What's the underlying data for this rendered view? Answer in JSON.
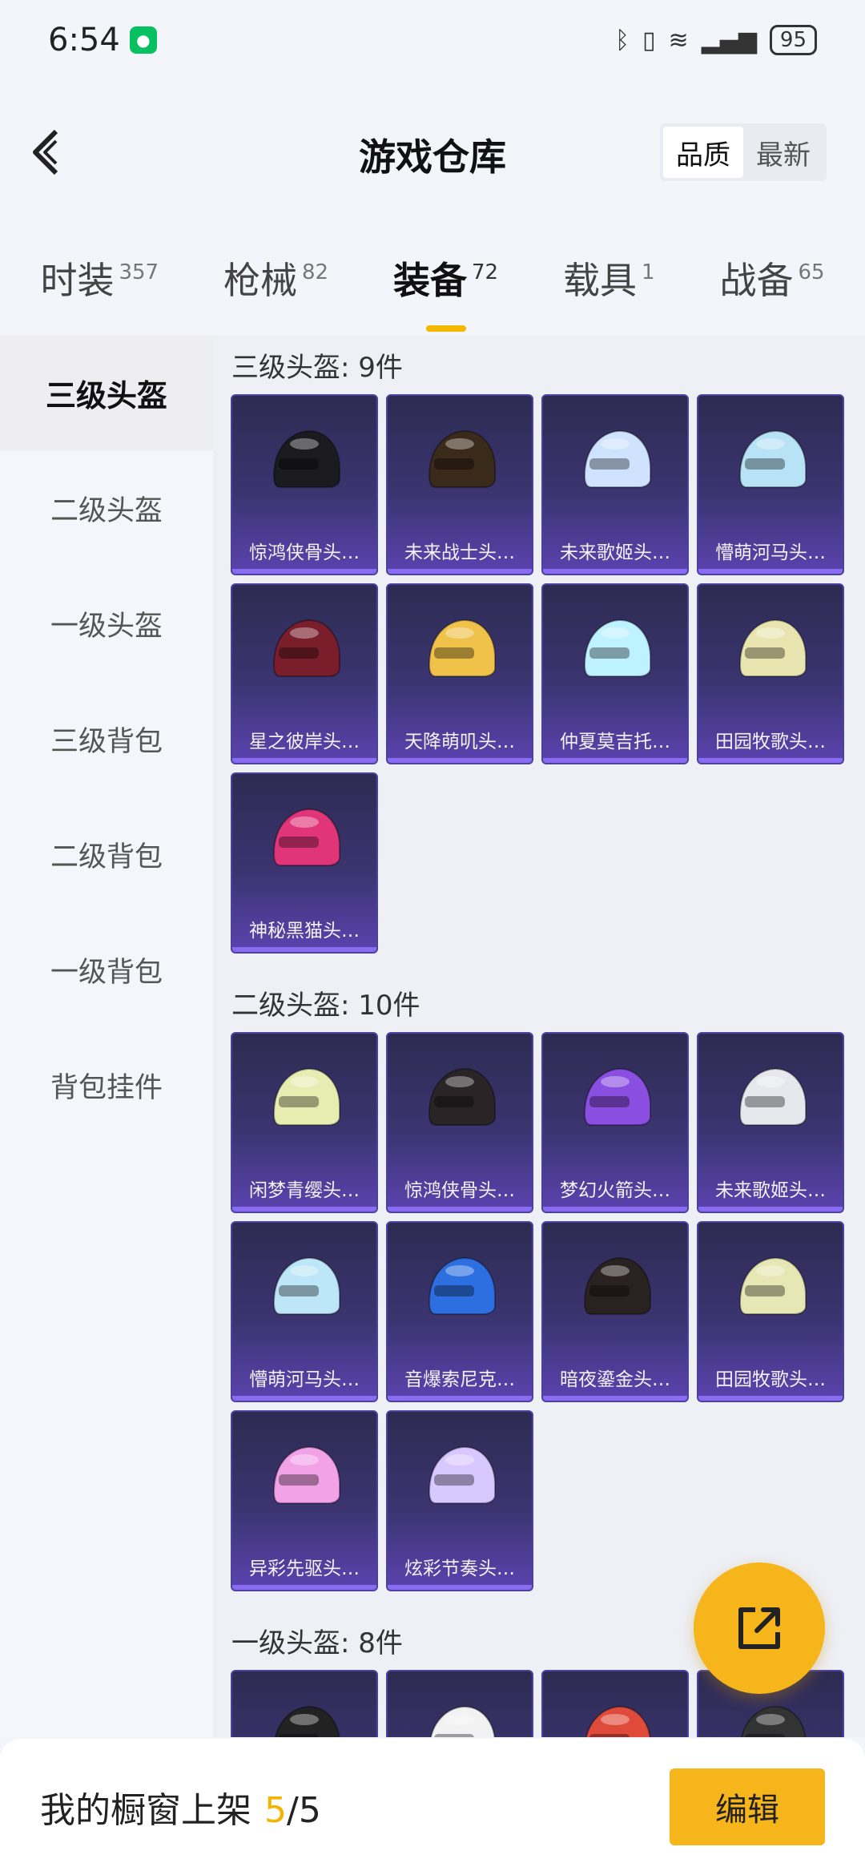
{
  "status_bar": {
    "time": "6:54",
    "battery": "95",
    "icons": [
      "wechat-icon",
      "bluetooth-icon",
      "vibrate-icon",
      "wifi-icon",
      "signal-4g-icon",
      "battery-icon"
    ]
  },
  "header": {
    "title": "游戏仓库",
    "segment": [
      "品质",
      "最新"
    ],
    "segment_active": "品质"
  },
  "tabs": [
    {
      "label": "时装",
      "count": "357"
    },
    {
      "label": "枪械",
      "count": "82"
    },
    {
      "label": "装备",
      "count": "72"
    },
    {
      "label": "载具",
      "count": "1"
    },
    {
      "label": "战备",
      "count": "65"
    }
  ],
  "active_tab": "装备",
  "sidebar": {
    "items": [
      "三级头盔",
      "二级头盔",
      "一级头盔",
      "三级背包",
      "二级背包",
      "一级背包",
      "背包挂件"
    ],
    "active": "三级头盔"
  },
  "sections": [
    {
      "title": "三级头盔: 9件",
      "items": [
        {
          "name": "惊鸿侠骨头…",
          "color": "#1b1b1f"
        },
        {
          "name": "未来战士头…",
          "color": "#3a2a1a"
        },
        {
          "name": "未来歌姬头…",
          "color": "#cfe3ff"
        },
        {
          "name": "懵萌河马头…",
          "color": "#b8e2f6"
        },
        {
          "name": "星之彼岸头…",
          "color": "#7a1e2c"
        },
        {
          "name": "天降萌叽头…",
          "color": "#f0c24a"
        },
        {
          "name": "仲夏莫吉托…",
          "color": "#bff2ff"
        },
        {
          "name": "田园牧歌头…",
          "color": "#e9e5b0"
        },
        {
          "name": "神秘黑猫头…",
          "color": "#e03578"
        }
      ]
    },
    {
      "title": "二级头盔: 10件",
      "items": [
        {
          "name": "闲梦青缨头…",
          "color": "#e7ecb0"
        },
        {
          "name": "惊鸿侠骨头…",
          "color": "#2a2426"
        },
        {
          "name": "梦幻火箭头…",
          "color": "#8a4fe0"
        },
        {
          "name": "未来歌姬头…",
          "color": "#e6e8ee"
        },
        {
          "name": "懵萌河马头…",
          "color": "#bde6f8"
        },
        {
          "name": "音爆索尼克…",
          "color": "#2d6fe0"
        },
        {
          "name": "暗夜鎏金头…",
          "color": "#2a2220"
        },
        {
          "name": "田园牧歌头…",
          "color": "#e6e7b4"
        },
        {
          "name": "异彩先驱头…",
          "color": "#f2a2e6"
        },
        {
          "name": "炫彩节奏头…",
          "color": "#d9c8ff"
        }
      ]
    },
    {
      "title": "一级头盔: 8件",
      "items": [
        {
          "name": "",
          "color": "#222"
        },
        {
          "name": "",
          "color": "#f2f2f2"
        },
        {
          "name": "",
          "color": "#e04a3a"
        },
        {
          "name": "",
          "color": "#333"
        }
      ]
    }
  ],
  "bottom": {
    "label": "我的橱窗上架",
    "count": "5",
    "sep": "/",
    "total": "5",
    "edit": "编辑"
  }
}
